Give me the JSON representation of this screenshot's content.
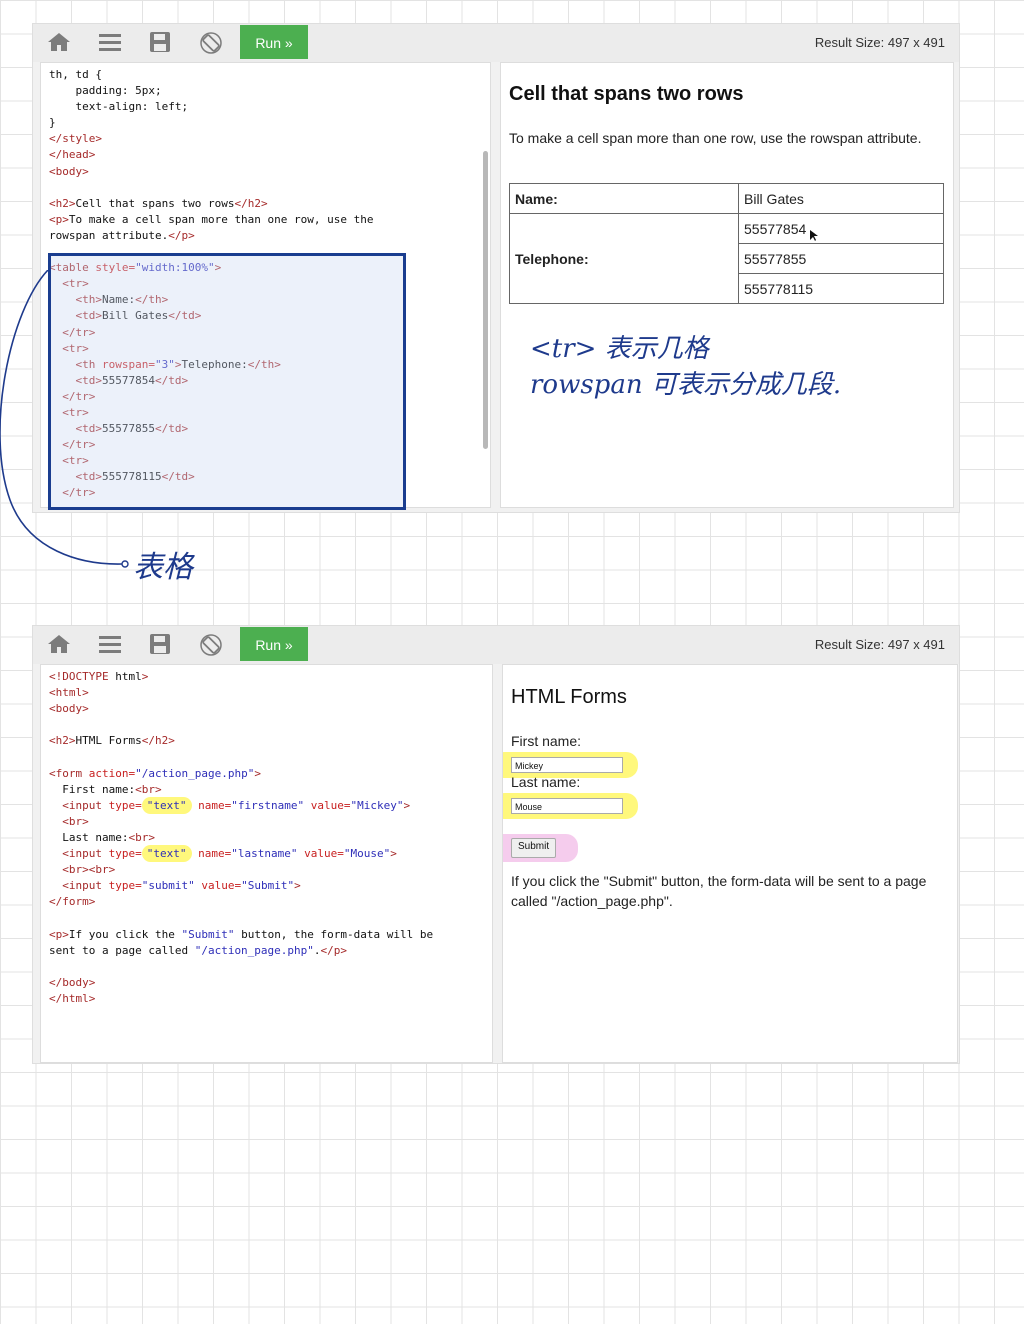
{
  "toolbar": {
    "icons": [
      "home-icon",
      "menu-icon",
      "save-icon",
      "rotate-icon"
    ],
    "run_label": "Run »",
    "result_size_label": "Result Size:",
    "result_size_value": "497 x 491"
  },
  "panel1": {
    "code_lines": [
      "th, td {",
      "    padding: 5px;",
      "    text-align: left;",
      "}",
      "</style>",
      "</head>",
      "<body>",
      "",
      "<h2>Cell that spans two rows</h2>",
      "<p>To make a cell span more than one row, use the",
      "rowspan attribute.</p>",
      "",
      "<table style=\"width:100%\">",
      "  <tr>",
      "    <th>Name:</th>",
      "    <td>Bill Gates</td>",
      "  </tr>",
      "  <tr>",
      "    <th rowspan=\"3\">Telephone:</th>",
      "    <td>55577854</td>",
      "  </tr>",
      "  <tr>",
      "    <td>55577855</td>",
      "  </tr>",
      "  <tr>",
      "    <td>555778115</td>",
      "  </tr>"
    ],
    "result": {
      "heading": "Cell that spans two rows",
      "paragraph": "To make a cell span more than one row, use the rowspan attribute.",
      "table": {
        "name_header": "Name:",
        "name_value": "Bill Gates",
        "telephone_header": "Telephone:",
        "telephones": [
          "55577854",
          "55577855",
          "555778115"
        ]
      }
    }
  },
  "annotations": {
    "note_line1": "<tr> 表示几格",
    "note_line2": "rowspan 可表示分成几段.",
    "label_table": "表格",
    "colors": {
      "ink": "#1e3a8c",
      "box": "#1a3d8f",
      "highlight_yellow": "#fff550",
      "highlight_pink": "#eeaae1"
    }
  },
  "panel2": {
    "code_lines": [
      "<!DOCTYPE html>",
      "<html>",
      "<body>",
      "",
      "<h2>HTML Forms</h2>",
      "",
      "<form action=\"/action_page.php\">",
      "  First name:<br>",
      "  <input type=\"text\" name=\"firstname\" value=\"Mickey\">",
      "  <br>",
      "  Last name:<br>",
      "  <input type=\"text\" name=\"lastname\" value=\"Mouse\">",
      "  <br><br>",
      "  <input type=\"submit\" value=\"Submit\">",
      "</form>",
      "",
      "<p>If you click the \"Submit\" button, the form-data will be",
      "sent to a page called \"/action_page.php\".</p>",
      "",
      "</body>",
      "</html>"
    ],
    "result": {
      "heading": "HTML Forms",
      "first_name_label": "First name:",
      "first_name_value": "Mickey",
      "last_name_label": "Last name:",
      "last_name_value": "Mouse",
      "submit_label": "Submit",
      "paragraph": "If you click the \"Submit\" button, the form-data will be sent to a page called \"/action_page.php\"."
    }
  }
}
